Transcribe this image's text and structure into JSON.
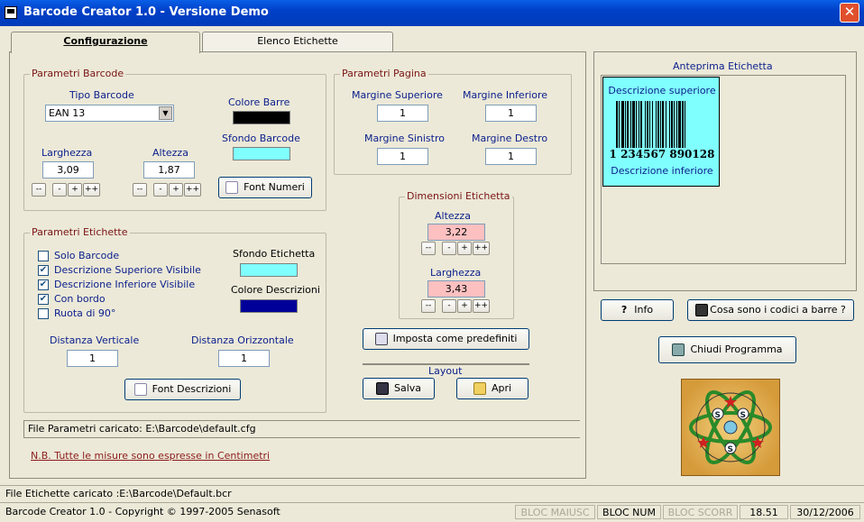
{
  "window": {
    "title": "Barcode Creator 1.0 - Versione Demo",
    "close": "✕"
  },
  "tabs": [
    {
      "label": "Configurazione"
    },
    {
      "label": "Elenco Etichette"
    }
  ],
  "barcode": {
    "group": "Parametri Barcode",
    "tipo_label": "Tipo Barcode",
    "tipo_value": "EAN 13",
    "colore_barre_label": "Colore Barre",
    "colore_barre": "#000000",
    "sfondo_label": "Sfondo Barcode",
    "sfondo_color": "#80ffff",
    "larghezza_label": "Larghezza",
    "larghezza_value": "3,09",
    "altezza_label": "Altezza",
    "altezza_value": "1,87",
    "font_btn": "Font Numeri"
  },
  "steppers": {
    "mm": "--",
    "m": "-",
    "p": "+",
    "pp": "++"
  },
  "pagina": {
    "group": "Parametri Pagina",
    "sup_label": "Margine Superiore",
    "sup_value": "1",
    "inf_label": "Margine Inferiore",
    "inf_value": "1",
    "sin_label": "Margine Sinistro",
    "sin_value": "1",
    "des_label": "Margine Destro",
    "des_value": "1"
  },
  "dimensioni": {
    "group": "Dimensioni Etichetta",
    "altezza_label": "Altezza",
    "altezza_value": "3,22",
    "larghezza_label": "Larghezza",
    "larghezza_value": "3,43"
  },
  "etichette": {
    "group": "Parametri Etichette",
    "checks": [
      {
        "label": "Solo Barcode",
        "checked": false
      },
      {
        "label": "Descrizione Superiore Visibile",
        "checked": true
      },
      {
        "label": "Descrizione Inferiore Visibile",
        "checked": true
      },
      {
        "label": "Con bordo",
        "checked": true
      },
      {
        "label": "Ruota di 90°",
        "checked": false
      }
    ],
    "sfondo_label": "Sfondo Etichetta",
    "sfondo_color": "#80ffff",
    "colore_desc_label": "Colore Descrizioni",
    "colore_desc": "#000099",
    "dist_vert_label": "Distanza Verticale",
    "dist_vert_value": "1",
    "dist_orizz_label": "Distanza Orizzontale",
    "dist_orizz_value": "1",
    "font_btn": "Font Descrizioni"
  },
  "buttons": {
    "predefiniti": "Imposta come predefiniti",
    "layout": "Layout",
    "salva": "Salva",
    "apri": "Apri"
  },
  "file_parametri": "File Parametri caricato: E:\\Barcode\\default.cfg",
  "note": "N.B. Tutte le misure sono espresse in Centimetri",
  "preview": {
    "title": "Anteprima Etichetta",
    "desc_sup": "Descrizione superiore",
    "number": "1 234567 890128",
    "desc_inf": "Descrizione inferiore",
    "bg": "#80ffff"
  },
  "right_buttons": {
    "info": "Info",
    "cosa": "Cosa sono i codici a barre ?",
    "chiudi": "Chiudi Programma"
  },
  "logo": {
    "text": "SSS"
  },
  "statusbar": {
    "file_etichette": "File Etichette caricato :E:\\Barcode\\Default.bcr",
    "copyright": "Barcode Creator 1.0 - Copyright © 1997-2005 Senasoft",
    "bloc_maiusc": "BLOC MAIUSC",
    "bloc_num": "BLOC NUM",
    "bloc_scorr": "BLOC SCORR",
    "time": "18.51",
    "date": "30/12/2006"
  }
}
